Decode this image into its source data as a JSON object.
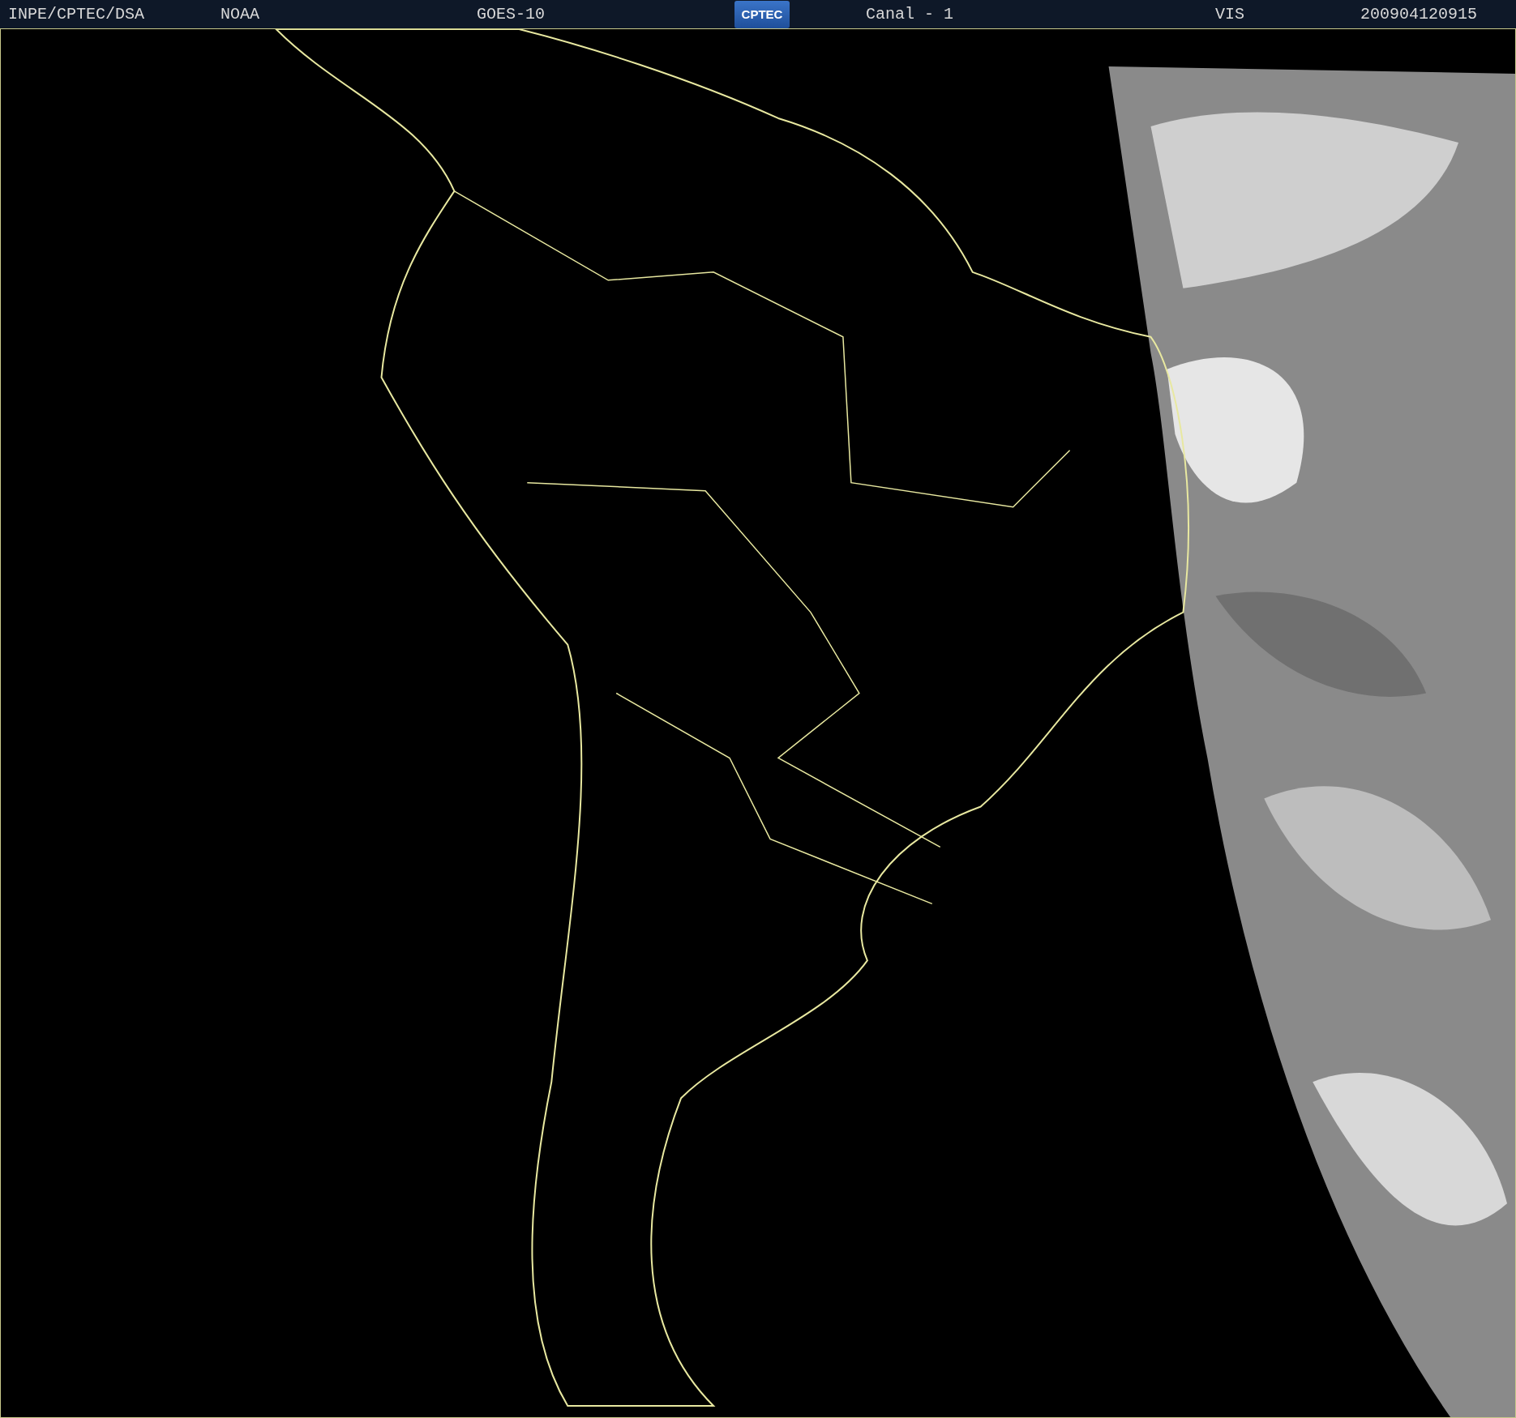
{
  "header": {
    "items": [
      {
        "kind": "text",
        "text": "INPE/CPTEC/DSA"
      },
      {
        "kind": "text",
        "text": "NOAA"
      },
      {
        "kind": "text",
        "text": "GOES-10"
      },
      {
        "kind": "logo",
        "text": "CPTEC"
      },
      {
        "kind": "text",
        "text": "Canal - 1"
      },
      {
        "kind": "text",
        "text": "VIS"
      },
      {
        "kind": "text",
        "text": "200904120915"
      }
    ]
  }
}
